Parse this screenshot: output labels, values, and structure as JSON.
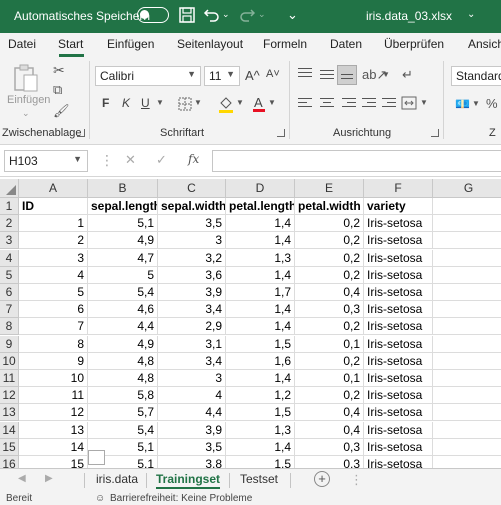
{
  "titlebar": {
    "autosave_label": "Automatisches Speichern",
    "filename": "iris.data_03.xlsx",
    "accent": "#217346"
  },
  "ribbon_tabs": [
    "Datei",
    "Start",
    "Einfügen",
    "Seitenlayout",
    "Formeln",
    "Daten",
    "Überprüfen",
    "Ansich"
  ],
  "active_tab": "Start",
  "ribbon": {
    "clipboard": {
      "paste_label": "Einfügen",
      "group_label": "Zwischenablage"
    },
    "font": {
      "font_name": "Calibri",
      "font_size": "11",
      "bold": "F",
      "italic": "K",
      "underline": "U",
      "group_label": "Schriftart",
      "grow": "A^",
      "shrink": "A˅"
    },
    "alignment": {
      "group_label": "Ausrichtung"
    },
    "number": {
      "format": "Standard"
    }
  },
  "formula_bar": {
    "name_box": "H103",
    "fx_label": "fx",
    "formula": ""
  },
  "columns": [
    "A",
    "B",
    "C",
    "D",
    "E",
    "F",
    "G"
  ],
  "rows": [
    "1",
    "2",
    "3",
    "4",
    "5",
    "6",
    "7",
    "8",
    "9",
    "10",
    "11",
    "12",
    "13",
    "14",
    "15",
    "16"
  ],
  "table": {
    "header": [
      "ID",
      "sepal.length",
      "sepal.width",
      "petal.length",
      "petal.width",
      "variety"
    ],
    "data": [
      [
        "1",
        "5,1",
        "3,5",
        "1,4",
        "0,2",
        "Iris-setosa"
      ],
      [
        "2",
        "4,9",
        "3",
        "1,4",
        "0,2",
        "Iris-setosa"
      ],
      [
        "3",
        "4,7",
        "3,2",
        "1,3",
        "0,2",
        "Iris-setosa"
      ],
      [
        "4",
        "5",
        "3,6",
        "1,4",
        "0,2",
        "Iris-setosa"
      ],
      [
        "5",
        "5,4",
        "3,9",
        "1,7",
        "0,4",
        "Iris-setosa"
      ],
      [
        "6",
        "4,6",
        "3,4",
        "1,4",
        "0,3",
        "Iris-setosa"
      ],
      [
        "7",
        "4,4",
        "2,9",
        "1,4",
        "0,2",
        "Iris-setosa"
      ],
      [
        "8",
        "4,9",
        "3,1",
        "1,5",
        "0,1",
        "Iris-setosa"
      ],
      [
        "9",
        "4,8",
        "3,4",
        "1,6",
        "0,2",
        "Iris-setosa"
      ],
      [
        "10",
        "4,8",
        "3",
        "1,4",
        "0,1",
        "Iris-setosa"
      ],
      [
        "11",
        "5,8",
        "4",
        "1,2",
        "0,2",
        "Iris-setosa"
      ],
      [
        "12",
        "5,7",
        "4,4",
        "1,5",
        "0,4",
        "Iris-setosa"
      ],
      [
        "13",
        "5,4",
        "3,9",
        "1,3",
        "0,4",
        "Iris-setosa"
      ],
      [
        "14",
        "5,1",
        "3,5",
        "1,4",
        "0,3",
        "Iris-setosa"
      ],
      [
        "15",
        "5,1",
        "3,8",
        "1,5",
        "0,3",
        "Iris-setosa"
      ]
    ]
  },
  "sheets": [
    "iris.data",
    "Trainingset",
    "Testset"
  ],
  "active_sheet": "Trainingset",
  "add_sheet": "+",
  "status": {
    "ready": "Bereit",
    "accessibility": "Barrierefreiheit: Keine Probleme"
  }
}
